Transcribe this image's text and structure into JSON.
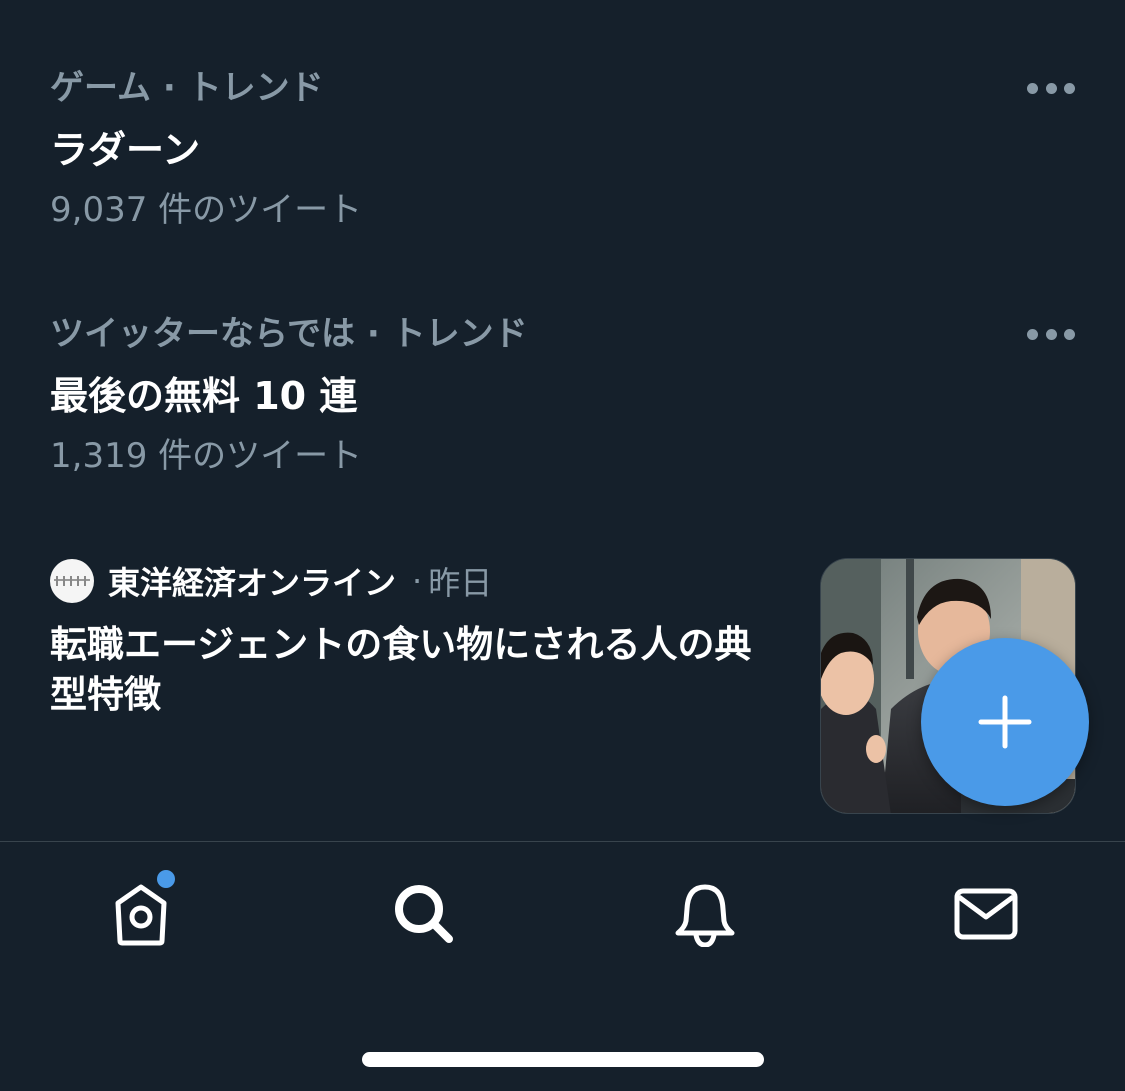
{
  "colors": {
    "background": "#15202b",
    "text_primary": "#ffffff",
    "text_secondary": "#8899a6",
    "accent": "#4a9ae8",
    "divider": "#38444d"
  },
  "trends": [
    {
      "meta": "ゲーム · トレンド",
      "title": "ラダーン",
      "count": "9,037 件のツイート",
      "more_icon": "more-horizontal-icon"
    },
    {
      "meta": "ツイッターならでは · トレンド",
      "title": "最後の無料 10 連",
      "count": "1,319 件のツイート",
      "more_icon": "more-horizontal-icon"
    }
  ],
  "news": {
    "source": "東洋経済オンライン",
    "separator": "·",
    "time": "昨日",
    "headline": "転職エージェントの食い物にされる人の典型特徴",
    "thumbnail": "business-people-photo"
  },
  "fab": {
    "icon": "plus-icon"
  },
  "tabbar": {
    "items": [
      {
        "name": "home",
        "icon": "home-icon",
        "has_badge": true
      },
      {
        "name": "search",
        "icon": "search-icon",
        "active": true
      },
      {
        "name": "notifications",
        "icon": "bell-icon"
      },
      {
        "name": "messages",
        "icon": "mail-icon"
      }
    ]
  }
}
